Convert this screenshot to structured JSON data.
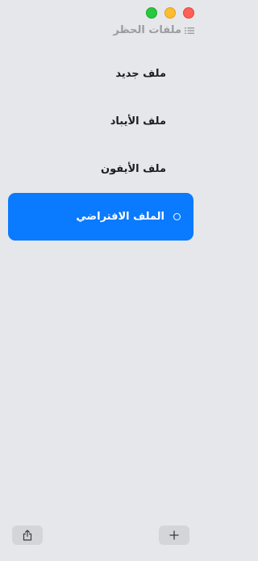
{
  "window": {
    "title": "ملفات الحظر",
    "title_icon": "list-icon",
    "controls": [
      "close",
      "minimize",
      "zoom"
    ],
    "colors": {
      "close": "#ff5f57",
      "minimize": "#febc2e",
      "zoom": "#28c840"
    }
  },
  "profiles": {
    "items": [
      {
        "label": "ملف جديد",
        "selected": false
      },
      {
        "label": "ملف الأيباد",
        "selected": false
      },
      {
        "label": "ملف الأيفون",
        "selected": false
      },
      {
        "label": "الملف الافتراضي",
        "selected": true
      }
    ],
    "selected_color": "#0a7aff"
  },
  "footer": {
    "share_icon": "share-icon",
    "add_icon": "plus-icon"
  }
}
